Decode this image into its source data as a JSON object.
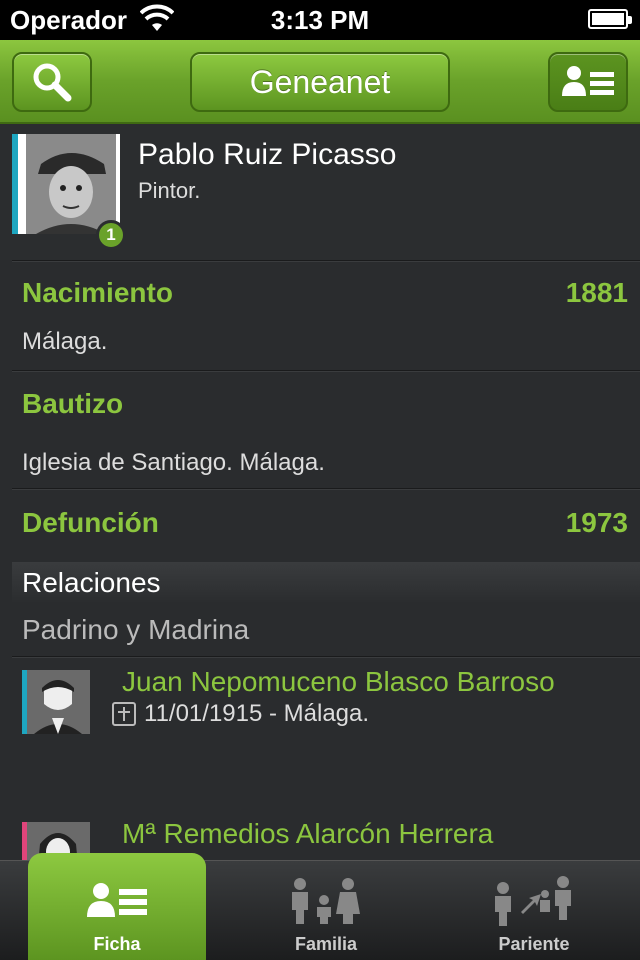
{
  "status": {
    "carrier": "Operador",
    "time": "3:13 PM"
  },
  "nav": {
    "title": "Geneanet"
  },
  "person": {
    "name": "Pablo Ruiz Picasso",
    "subtitle": "Pintor.",
    "badge": "1"
  },
  "events": [
    {
      "title": "Nacimiento",
      "year": "1881",
      "text": "Málaga."
    },
    {
      "title": "Bautizo",
      "year": "",
      "text": "Iglesia de Santiago. Málaga."
    },
    {
      "title": "Defunción",
      "year": "1973",
      "text": ""
    }
  ],
  "relaciones": {
    "header": "Relaciones",
    "group": "Padrino y Madrina",
    "items": [
      {
        "name": "Juan Nepomuceno Blasco Barroso",
        "detail": "11/01/1915 - Málaga.",
        "accent": "#1ea6c0"
      },
      {
        "name": "Mª Remedios Alarcón Herrera",
        "detail": "",
        "accent": "#e0457b"
      }
    ]
  },
  "tabs": [
    {
      "label": "Ficha"
    },
    {
      "label": "Familia"
    },
    {
      "label": "Pariente"
    }
  ],
  "colors": {
    "brand_green": "#8cc63f",
    "background": "#2a2c2e"
  }
}
